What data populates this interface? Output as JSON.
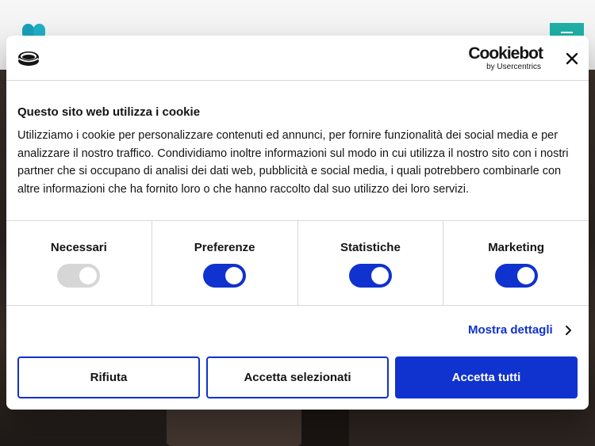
{
  "cookiebot": {
    "brand_name": "Cookiebot",
    "brand_by": "by Usercentrics",
    "title": "Questo sito web utilizza i cookie",
    "body": "Utilizziamo i cookie per personalizzare contenuti ed annunci, per fornire funzionalità dei social media e per analizzare il nostro traffico. Condividiamo inoltre informazioni sul modo in cui utilizza il nostro sito con i nostri partner che si occupano di analisi dei dati web, pubblicità e social media, i quali potrebbero combinarle con altre informazioni che ha fornito loro o che hanno raccolto dal suo utilizzo dei loro servizi.",
    "toggles": [
      {
        "label": "Necessari",
        "on": true,
        "disabled": true
      },
      {
        "label": "Preferenze",
        "on": true,
        "disabled": false
      },
      {
        "label": "Statistiche",
        "on": true,
        "disabled": false
      },
      {
        "label": "Marketing",
        "on": true,
        "disabled": false
      }
    ],
    "details_link": "Mostra dettagli",
    "buttons": {
      "reject": "Rifiuta",
      "accept_selected": "Accetta selezionati",
      "accept_all": "Accetta tutti"
    },
    "colors": {
      "accent": "#1032cf",
      "toggle_disabled": "#d6d6d6",
      "site_menu": "#1fb0a6"
    },
    "icons": {
      "header": "cookie-icon",
      "close": "close-icon",
      "details": "chevron-right-icon"
    }
  }
}
